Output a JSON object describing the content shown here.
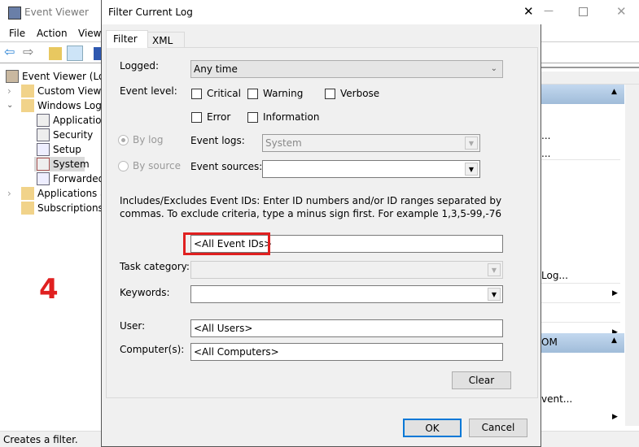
{
  "main_window": {
    "title": "Event Viewer",
    "menu": [
      "File",
      "Action",
      "View"
    ],
    "tree": [
      {
        "label": "Event Viewer (Local)",
        "level": 0
      },
      {
        "label": "Custom Views",
        "level": 1,
        "expander": "collapsed"
      },
      {
        "label": "Windows Logs",
        "level": 1,
        "expander": "expanded"
      },
      {
        "label": "Application",
        "level": 2
      },
      {
        "label": "Security",
        "level": 2
      },
      {
        "label": "Setup",
        "level": 2
      },
      {
        "label": "System",
        "level": 2,
        "selected": true
      },
      {
        "label": "Forwarded Events",
        "level": 2
      },
      {
        "label": "Applications and Services Logs",
        "level": 1,
        "expander": "collapsed"
      },
      {
        "label": "Subscriptions",
        "level": 1
      }
    ],
    "actions_partial": [
      "...",
      "...",
      "Log...",
      "OM",
      "vent..."
    ],
    "status": "Creates a filter.",
    "annotation": "4",
    "header_color": "#b9d1ea",
    "annotation_color": "#e02020"
  },
  "dialog": {
    "title": "Filter Current Log",
    "tabs": [
      "Filter",
      "XML"
    ],
    "active_tab": "Filter",
    "logged_label": "Logged:",
    "logged_value": "Any time",
    "event_level_label": "Event level:",
    "levels": [
      {
        "label": "Critical",
        "checked": false
      },
      {
        "label": "Warning",
        "checked": false
      },
      {
        "label": "Verbose",
        "checked": false
      },
      {
        "label": "Error",
        "checked": false
      },
      {
        "label": "Information",
        "checked": false
      }
    ],
    "by_log_label": "By log",
    "by_source_label": "By source",
    "event_logs_label": "Event logs:",
    "event_logs_value": "System",
    "event_sources_label": "Event sources:",
    "event_sources_value": "",
    "description": "Includes/Excludes Event IDs: Enter ID numbers and/or ID ranges separated by commas. To exclude criteria, type a minus sign first. For example 1,3,5-99,-76",
    "event_ids_value": "<All Event IDs>",
    "task_category_label": "Task category:",
    "keywords_label": "Keywords:",
    "user_label": "User:",
    "user_value": "<All Users>",
    "computer_label": "Computer(s):",
    "computer_value": "<All Computers>",
    "clear_label": "Clear",
    "ok_label": "OK",
    "cancel_label": "Cancel",
    "highlight_color": "#e02020"
  }
}
